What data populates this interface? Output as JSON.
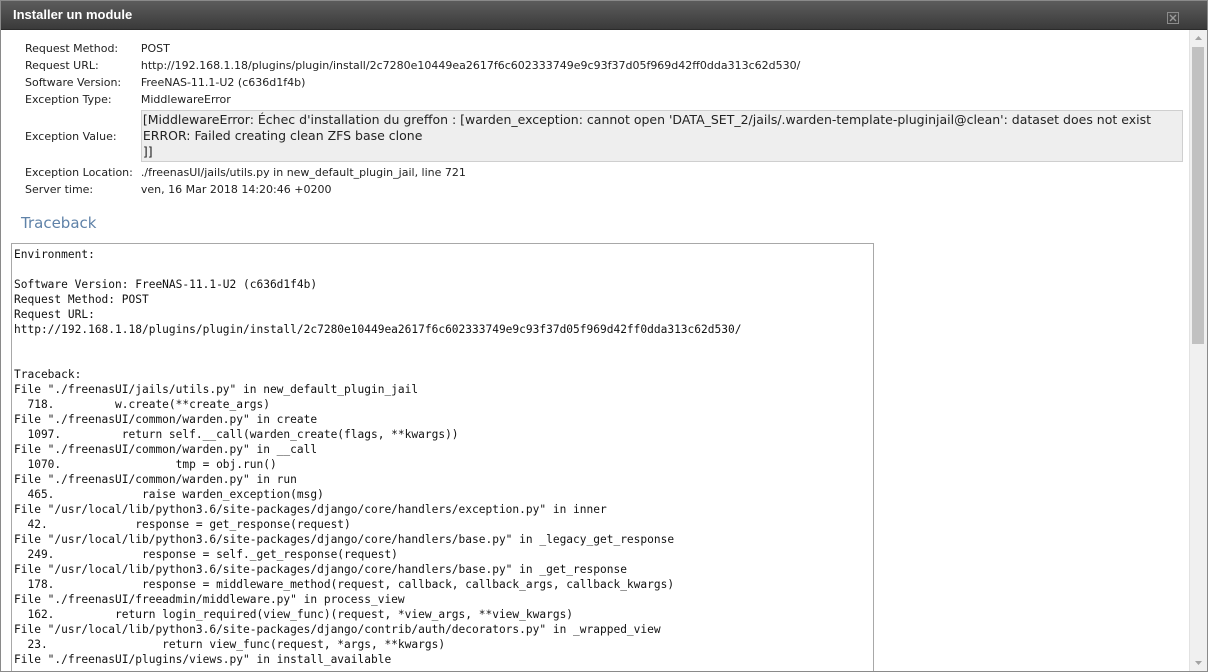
{
  "window": {
    "title": "Installer un module",
    "close_icon": "close-icon"
  },
  "meta": [
    {
      "key": "Request Method:",
      "value": "POST"
    },
    {
      "key": "Request URL:",
      "value": "http://192.168.1.18/plugins/plugin/install/2c7280e10449ea2617f6c602333749e9c93f37d05f969d42ff0dda313c62d530/"
    },
    {
      "key": "Software Version:",
      "value": "FreeNAS-11.1-U2 (c636d1f4b)"
    },
    {
      "key": "Exception Type:",
      "value": "MiddlewareError"
    },
    {
      "key": "Exception Value:",
      "value": "[MiddlewareError: Échec d'installation du greffon : [warden_exception: cannot open 'DATA_SET_2/jails/.warden-template-pluginjail@clean': dataset does not exist\nERROR: Failed creating clean ZFS base clone\n]]"
    },
    {
      "key": "Exception Location:",
      "value": "./freenasUI/jails/utils.py in new_default_plugin_jail, line 721"
    },
    {
      "key": "Server time:",
      "value": "ven, 16 Mar 2018 14:20:46 +0200"
    }
  ],
  "traceback": {
    "heading": "Traceback",
    "text": "Environment:\n\nSoftware Version: FreeNAS-11.1-U2 (c636d1f4b)\nRequest Method: POST\nRequest URL:\nhttp://192.168.1.18/plugins/plugin/install/2c7280e10449ea2617f6c602333749e9c93f37d05f969d42ff0dda313c62d530/\n\n\nTraceback:\nFile \"./freenasUI/jails/utils.py\" in new_default_plugin_jail\n  718.         w.create(**create_args)\nFile \"./freenasUI/common/warden.py\" in create\n  1097.         return self.__call(warden_create(flags, **kwargs))\nFile \"./freenasUI/common/warden.py\" in __call\n  1070.                 tmp = obj.run()\nFile \"./freenasUI/common/warden.py\" in run\n  465.             raise warden_exception(msg)\nFile \"/usr/local/lib/python3.6/site-packages/django/core/handlers/exception.py\" in inner\n  42.             response = get_response(request)\nFile \"/usr/local/lib/python3.6/site-packages/django/core/handlers/base.py\" in _legacy_get_response\n  249.             response = self._get_response(request)\nFile \"/usr/local/lib/python3.6/site-packages/django/core/handlers/base.py\" in _get_response\n  178.             response = middleware_method(request, callback, callback_args, callback_kwargs)\nFile \"./freenasUI/freeadmin/middleware.py\" in process_view\n  162.         return login_required(view_func)(request, *view_args, **view_kwargs)\nFile \"/usr/local/lib/python3.6/site-packages/django/contrib/auth/decorators.py\" in _wrapped_view\n  23.                 return view_func(request, *args, **kwargs)\nFile \"./freenasUI/plugins/views.py\" in install_available"
  },
  "colors": {
    "titlebar": "#4a4a4a",
    "heading": "#5f82a8",
    "exception_bg": "#eeeeee"
  }
}
